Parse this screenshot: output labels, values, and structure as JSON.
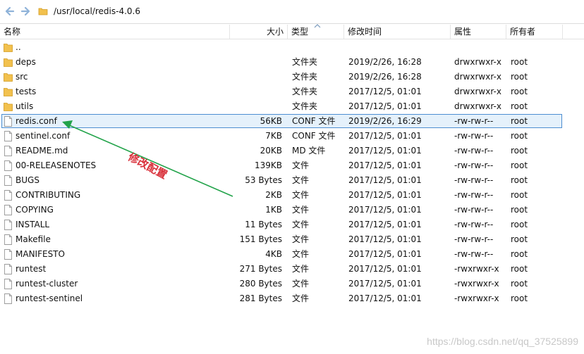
{
  "address_bar": {
    "path": "/usr/local/redis-4.0.6",
    "back_icon": "arrow-left-icon",
    "forward_icon": "arrow-right-icon",
    "folder_icon": "folder-icon"
  },
  "columns": {
    "name": "名称",
    "size": "大小",
    "type": "类型",
    "mtime": "修改时间",
    "attr": "属性",
    "owner": "所有者",
    "sorted_by": "type"
  },
  "files": [
    {
      "name": "..",
      "size": "",
      "type": "",
      "mtime": "",
      "attr": "",
      "owner": "",
      "icon": "folder-icon"
    },
    {
      "name": "deps",
      "size": "",
      "type": "文件夹",
      "mtime": "2019/2/26, 16:28",
      "attr": "drwxrwxr-x",
      "owner": "root",
      "icon": "folder-icon"
    },
    {
      "name": "src",
      "size": "",
      "type": "文件夹",
      "mtime": "2019/2/26, 16:28",
      "attr": "drwxrwxr-x",
      "owner": "root",
      "icon": "folder-icon"
    },
    {
      "name": "tests",
      "size": "",
      "type": "文件夹",
      "mtime": "2017/12/5, 01:01",
      "attr": "drwxrwxr-x",
      "owner": "root",
      "icon": "folder-icon"
    },
    {
      "name": "utils",
      "size": "",
      "type": "文件夹",
      "mtime": "2017/12/5, 01:01",
      "attr": "drwxrwxr-x",
      "owner": "root",
      "icon": "folder-icon"
    },
    {
      "name": "redis.conf",
      "size": "56KB",
      "type": "CONF 文件",
      "mtime": "2019/2/26, 16:29",
      "attr": "-rw-rw-r--",
      "owner": "root",
      "icon": "file-icon",
      "selected": true
    },
    {
      "name": "sentinel.conf",
      "size": "7KB",
      "type": "CONF 文件",
      "mtime": "2017/12/5, 01:01",
      "attr": "-rw-rw-r--",
      "owner": "root",
      "icon": "file-icon"
    },
    {
      "name": "README.md",
      "size": "20KB",
      "type": "MD 文件",
      "mtime": "2017/12/5, 01:01",
      "attr": "-rw-rw-r--",
      "owner": "root",
      "icon": "file-icon"
    },
    {
      "name": "00-RELEASENOTES",
      "size": "139KB",
      "type": "文件",
      "mtime": "2017/12/5, 01:01",
      "attr": "-rw-rw-r--",
      "owner": "root",
      "icon": "file-icon"
    },
    {
      "name": "BUGS",
      "size": "53 Bytes",
      "type": "文件",
      "mtime": "2017/12/5, 01:01",
      "attr": "-rw-rw-r--",
      "owner": "root",
      "icon": "file-icon"
    },
    {
      "name": "CONTRIBUTING",
      "size": "2KB",
      "type": "文件",
      "mtime": "2017/12/5, 01:01",
      "attr": "-rw-rw-r--",
      "owner": "root",
      "icon": "file-icon"
    },
    {
      "name": "COPYING",
      "size": "1KB",
      "type": "文件",
      "mtime": "2017/12/5, 01:01",
      "attr": "-rw-rw-r--",
      "owner": "root",
      "icon": "file-icon"
    },
    {
      "name": "INSTALL",
      "size": "11 Bytes",
      "type": "文件",
      "mtime": "2017/12/5, 01:01",
      "attr": "-rw-rw-r--",
      "owner": "root",
      "icon": "file-icon"
    },
    {
      "name": "Makefile",
      "size": "151 Bytes",
      "type": "文件",
      "mtime": "2017/12/5, 01:01",
      "attr": "-rw-rw-r--",
      "owner": "root",
      "icon": "file-icon"
    },
    {
      "name": "MANIFESTO",
      "size": "4KB",
      "type": "文件",
      "mtime": "2017/12/5, 01:01",
      "attr": "-rw-rw-r--",
      "owner": "root",
      "icon": "file-icon"
    },
    {
      "name": "runtest",
      "size": "271 Bytes",
      "type": "文件",
      "mtime": "2017/12/5, 01:01",
      "attr": "-rwxrwxr-x",
      "owner": "root",
      "icon": "file-icon"
    },
    {
      "name": "runtest-cluster",
      "size": "280 Bytes",
      "type": "文件",
      "mtime": "2017/12/5, 01:01",
      "attr": "-rwxrwxr-x",
      "owner": "root",
      "icon": "file-icon"
    },
    {
      "name": "runtest-sentinel",
      "size": "281 Bytes",
      "type": "文件",
      "mtime": "2017/12/5, 01:01",
      "attr": "-rwxrwxr-x",
      "owner": "root",
      "icon": "file-icon"
    }
  ],
  "annotation": {
    "text": "修改配置",
    "text_color": "#d9303a",
    "arrow_color": "#22a34a"
  },
  "watermark": "https://blog.csdn.net/qq_37525899",
  "colors": {
    "folder": "#f2c14e",
    "selection_fill": "#e5f1fb",
    "selection_border": "#4d8ed1"
  }
}
